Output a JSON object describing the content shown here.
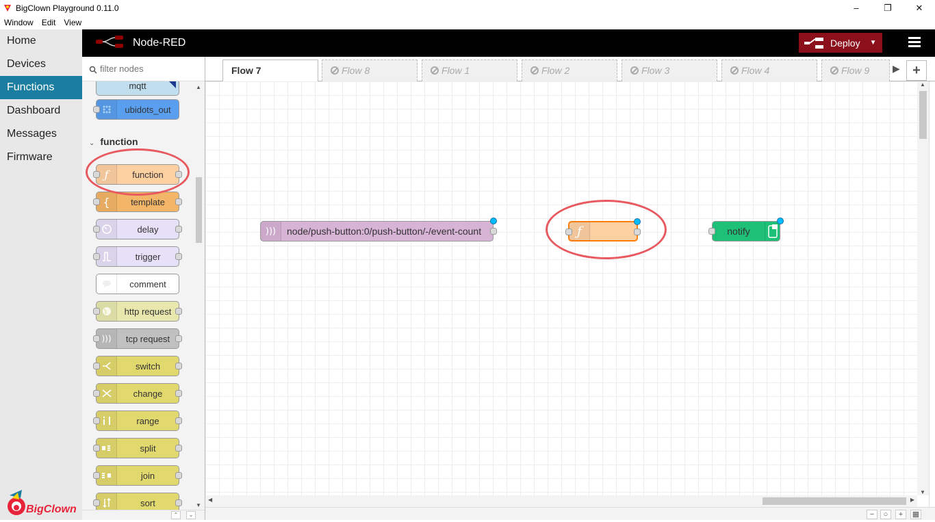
{
  "window": {
    "title": "BigClown Playground 0.11.0",
    "controls": [
      "–",
      "❐",
      "✕"
    ]
  },
  "menubar": {
    "items": [
      "Window",
      "Edit",
      "View"
    ]
  },
  "appnav": {
    "items": [
      {
        "label": "Home"
      },
      {
        "label": "Devices"
      },
      {
        "label": "Functions",
        "active": true
      },
      {
        "label": "Dashboard"
      },
      {
        "label": "Messages"
      },
      {
        "label": "Firmware"
      }
    ],
    "accent": "#1b7ea1"
  },
  "nodered": {
    "title": "Node-RED",
    "deploy_label": "Deploy",
    "deploy_color": "#8c101c"
  },
  "palette": {
    "filter_placeholder": "filter nodes",
    "category": "function",
    "nodes": [
      {
        "label": "mqtt",
        "color": "#c0deed"
      },
      {
        "label": "ubidots_out",
        "color": "#5a9fef"
      },
      {
        "label": "function",
        "color": "#fdd0a2",
        "icon": "function-icon"
      },
      {
        "label": "template",
        "color": "#f3b567",
        "icon": "template-icon"
      },
      {
        "label": "delay",
        "color": "#e6e0f8",
        "icon": "timer-icon"
      },
      {
        "label": "trigger",
        "color": "#e6e0f8",
        "icon": "trigger-icon"
      },
      {
        "label": "comment",
        "color": "#ffffff",
        "icon": "comment-icon"
      },
      {
        "label": "http request",
        "color": "#e7e7ae",
        "icon": "globe-icon"
      },
      {
        "label": "tcp request",
        "color": "#c0c0c0",
        "icon": "bridge-icon"
      },
      {
        "label": "switch",
        "color": "#e2d96e",
        "icon": "switch-icon"
      },
      {
        "label": "change",
        "color": "#e2d96e",
        "icon": "swap-icon"
      },
      {
        "label": "range",
        "color": "#e2d96e",
        "icon": "range-icon"
      },
      {
        "label": "split",
        "color": "#e2d96e",
        "icon": "split-icon"
      },
      {
        "label": "join",
        "color": "#e2d96e",
        "icon": "join-icon"
      },
      {
        "label": "sort",
        "color": "#e2d96e",
        "icon": "sort-icon"
      }
    ]
  },
  "tabs": [
    {
      "label": "Flow 7",
      "active": true
    },
    {
      "label": "Flow 8",
      "disabled": true
    },
    {
      "label": "Flow 1",
      "disabled": true
    },
    {
      "label": "Flow 2",
      "disabled": true
    },
    {
      "label": "Flow 3",
      "disabled": true
    },
    {
      "label": "Flow 4",
      "disabled": true
    },
    {
      "label": "Flow 9",
      "disabled": true
    }
  ],
  "workspace": {
    "nodes": [
      {
        "label": "node/push-button:0/push-button/-/event-count",
        "color": "#d7b3d6",
        "icon": "mqtt-in-icon"
      },
      {
        "label": "",
        "color": "#fdd0a2",
        "icon": "function-icon"
      },
      {
        "label": "notify",
        "color": "#1ec077",
        "icon": "phone-icon"
      }
    ]
  },
  "highlight_color": "#e85a5f"
}
